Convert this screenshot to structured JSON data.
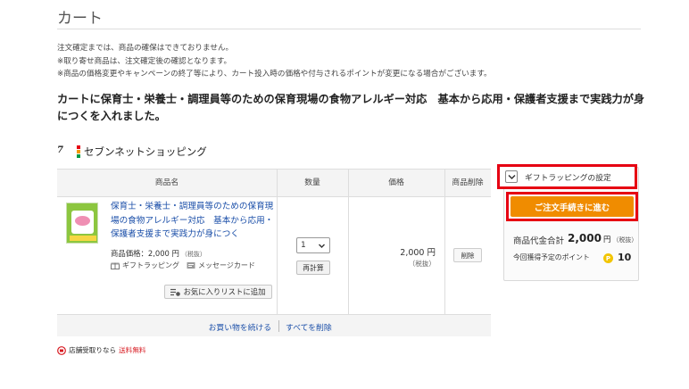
{
  "page": {
    "title": "カート"
  },
  "notices": [
    "注文確定までは、商品の確保はできておりません。",
    "※取り寄せ商品は、注文確定後の確認となります。",
    "※商品の価格変更やキャンペーンの終了等により、カート投入時の価格や付与されるポイントが変更になる場合がございます。"
  ],
  "cart_message": "カートに保育士・栄養士・調理員等のための保育現場の食物アレルギー対応　基本から応用・保護者支援まで実践力が身につくを入れました。",
  "shop": {
    "logo_text": "7",
    "name": "セブンネットショッピング"
  },
  "table": {
    "headers": {
      "name": "商品名",
      "quantity": "数量",
      "price": "価格",
      "delete": "商品削除"
    },
    "item": {
      "title": "保育士・栄養士・調理員等のための保育現場の食物アレルギー対応　基本から応用・保護者支援まで実践力が身につく",
      "price_label": "商品価格：2,000 円",
      "price_tax": "（税抜）",
      "gift_wrapping": "ギフトラッピング",
      "message_card": "メッセージカード",
      "favorite_button": "お気に入りリストに追加",
      "quantity": "1",
      "recalc_button": "再計算",
      "price": "2,000 円",
      "price_tax_note": "（税抜）",
      "delete_button": "削除"
    },
    "footer": {
      "continue_shopping": "お買い物を続ける",
      "delete_all": "すべてを削除"
    }
  },
  "store_pickup": {
    "prefix": "店舗受取りなら",
    "highlight": "送料無料"
  },
  "summary": {
    "gift_setting_label": "ギフトラッピングの設定",
    "checkout_button": "ご注文手続きに進む",
    "subtotal_label": "商品代金合計",
    "subtotal_value": "2,000",
    "subtotal_unit": "円",
    "subtotal_tax": "（税抜）",
    "points_label": "今回獲得予定のポイント",
    "points_coin": "P",
    "points_value": "10"
  },
  "colors": {
    "accent_orange": "#f08c00",
    "highlight_red": "#e60012",
    "link_blue": "#1a4ea8"
  }
}
